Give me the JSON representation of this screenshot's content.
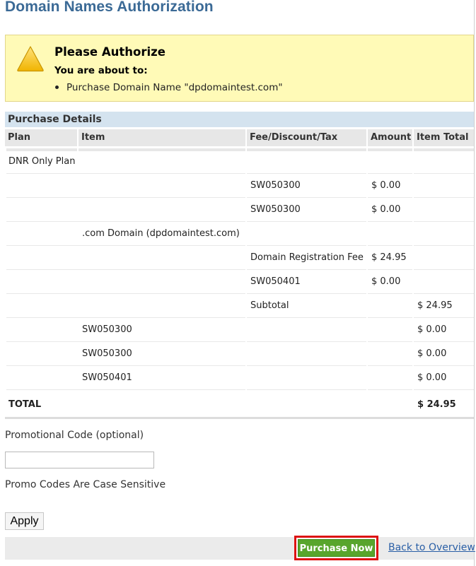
{
  "page": {
    "title": "Domain Names Authorization"
  },
  "alert": {
    "icon": "warning-triangle-icon",
    "title": "Please Authorize",
    "subtitle": "You are about to:",
    "items": [
      "Purchase Domain Name \"dpdomaintest.com\""
    ]
  },
  "details": {
    "section_title": "Purchase Details",
    "columns": [
      "Plan",
      "Item",
      "Fee/Discount/Tax",
      "Amount",
      "Item Total"
    ],
    "rows": [
      {
        "plan": "DNR Only Plan",
        "item": "",
        "fee": "",
        "amount": "",
        "total": ""
      },
      {
        "plan": "",
        "item": "",
        "fee": "SW050300",
        "amount": "$ 0.00",
        "total": ""
      },
      {
        "plan": "",
        "item": "",
        "fee": "SW050300",
        "amount": "$ 0.00",
        "total": ""
      },
      {
        "plan": "",
        "item": ".com Domain (dpdomaintest.com)",
        "fee": "",
        "amount": "",
        "total": ""
      },
      {
        "plan": "",
        "item": "",
        "fee": "Domain Registration Fee",
        "amount": "$ 24.95",
        "total": ""
      },
      {
        "plan": "",
        "item": "",
        "fee": "SW050401",
        "amount": "$ 0.00",
        "total": ""
      },
      {
        "plan": "",
        "item": "",
        "fee": "Subtotal",
        "amount": "",
        "total": "$ 24.95"
      },
      {
        "plan": "",
        "item": "SW050300",
        "fee": "",
        "amount": "",
        "total": "$ 0.00"
      },
      {
        "plan": "",
        "item": "SW050300",
        "fee": "",
        "amount": "",
        "total": "$ 0.00"
      },
      {
        "plan": "",
        "item": "SW050401",
        "fee": "",
        "amount": "",
        "total": "$ 0.00"
      }
    ],
    "total_label": "TOTAL",
    "total_value": "$ 24.95"
  },
  "promo": {
    "label": "Promotional Code (optional)",
    "value": "",
    "placeholder": "",
    "note": "Promo Codes Are Case Sensitive",
    "apply_label": "Apply"
  },
  "actions": {
    "purchase_label": "Purchase Now",
    "back_label": "Back to Overview"
  },
  "colors": {
    "title": "#3b6a96",
    "alert_bg": "#fffab7",
    "section_header": "#d4e3ef",
    "purchase_button": "#58a52c",
    "purchase_highlight": "#dd1111",
    "link": "#2a5fa6"
  }
}
